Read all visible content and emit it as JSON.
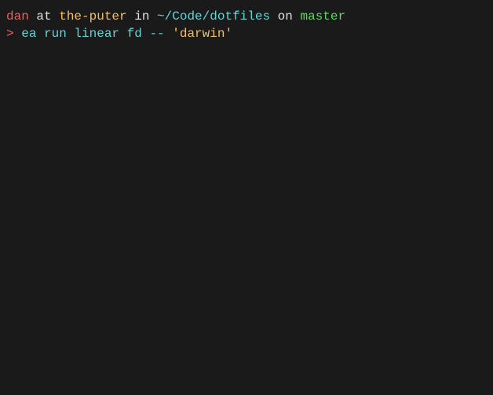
{
  "terminal": {
    "line1": {
      "parts": [
        {
          "text": "dan",
          "color": "red"
        },
        {
          "text": " at ",
          "color": "white"
        },
        {
          "text": "the-puter",
          "color": "yellow"
        },
        {
          "text": " in ",
          "color": "white"
        },
        {
          "text": "~/Code/dotfiles",
          "color": "cyan"
        },
        {
          "text": " on ",
          "color": "white"
        },
        {
          "text": "master",
          "color": "green"
        }
      ]
    },
    "line2": {
      "prompt": ">",
      "command_part1": " ea run linear fd -- ",
      "command_string": "'darwin'"
    }
  }
}
